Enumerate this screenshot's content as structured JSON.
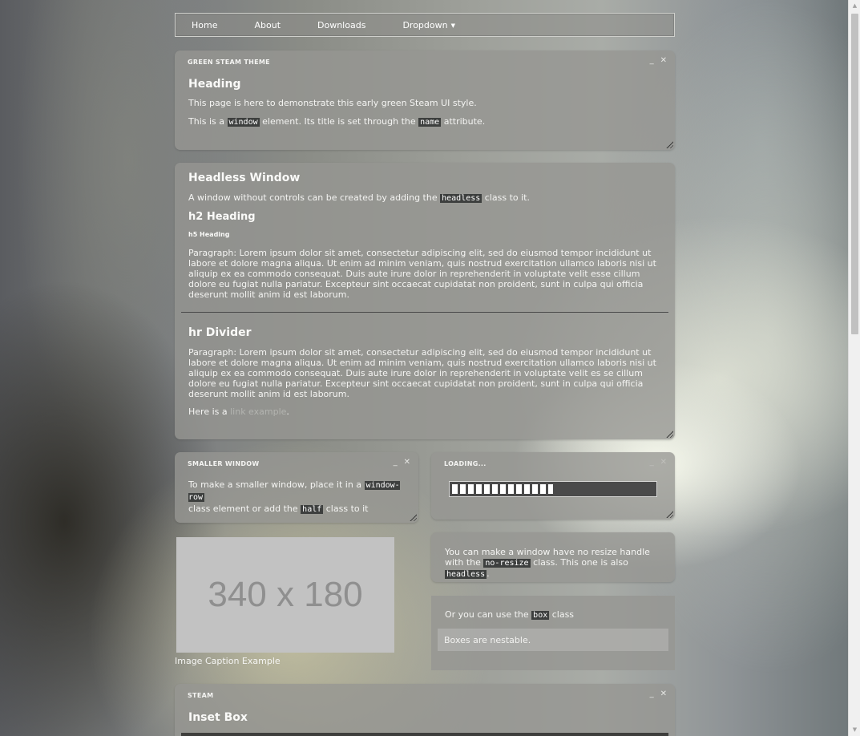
{
  "nav": {
    "items": [
      "Home",
      "About",
      "Downloads",
      "Dropdown"
    ]
  },
  "win1": {
    "title": "GREEN STEAM THEME",
    "heading": "Heading",
    "p1": "This page is here to demonstrate this early green Steam UI style.",
    "p2_before": "This is a ",
    "p2_code1": "window",
    "p2_mid": " element. Its title is set through the ",
    "p2_code2": "name",
    "p2_after": " attribute."
  },
  "win2": {
    "heading": "Headless Window",
    "p_before": "A window without controls can be created by adding the ",
    "p_code": "headless",
    "p_after": " class to it.",
    "h2": "h2 Heading",
    "h5": "h5 Heading",
    "para1": "Paragraph: Lorem ipsum dolor sit amet, consectetur adipiscing elit, sed do eiusmod tempor incididunt ut labore et dolore magna aliqua. Ut enim ad minim veniam, quis nostrud exercitation ullamco laboris nisi ut aliquip ex ea commodo consequat. Duis aute irure dolor in reprehenderit in voluptate velit esse cillum dolore eu fugiat nulla pariatur. Excepteur sint occaecat cupidatat non proident, sunt in culpa qui officia deserunt mollit anim id est laborum.",
    "hr_heading": "hr Divider",
    "para2": "Paragraph: Lorem ipsum dolor sit amet, consectetur adipiscing elit, sed do eiusmod tempor incididunt ut labore et dolore magna aliqua. Ut enim ad minim veniam, quis nostrud exercitation ullamco laboris nisi ut aliquip ex ea commodo consequat. Duis aute irure dolor in reprehenderit in voluptate velit es se cillum dolore eu fugiat nulla pariatur. Excepteur sint occaecat cupidatat non proident, sunt in culpa qui officia deserunt mollit anim id est laborum.",
    "link_before": "Here is a ",
    "link_text": "link example",
    "link_after": "."
  },
  "win3": {
    "title": "SMALLER WINDOW",
    "p_before": "To make a smaller window, place it in a ",
    "code1": "window-row",
    "p_mid": "class element or add the ",
    "code2": "half",
    "p_after": " class to it"
  },
  "win4": {
    "title": "LOADING...",
    "progress": 0.5
  },
  "win5": {
    "p_before": "You can make a window have no resize handle with the ",
    "code1": "no-resize",
    "p_mid": " class. This one is also ",
    "code2": "headless",
    "p_after": "."
  },
  "box": {
    "p_before": "Or you can use the ",
    "code": "box",
    "p_after": " class",
    "inner": "Boxes are nestable."
  },
  "image": {
    "placeholder": "340 x 180",
    "caption": "Image Caption Example"
  },
  "win6": {
    "title": "STEAM",
    "heading": "Inset Box"
  },
  "controls": {
    "minimize": "_",
    "close": "✕"
  }
}
